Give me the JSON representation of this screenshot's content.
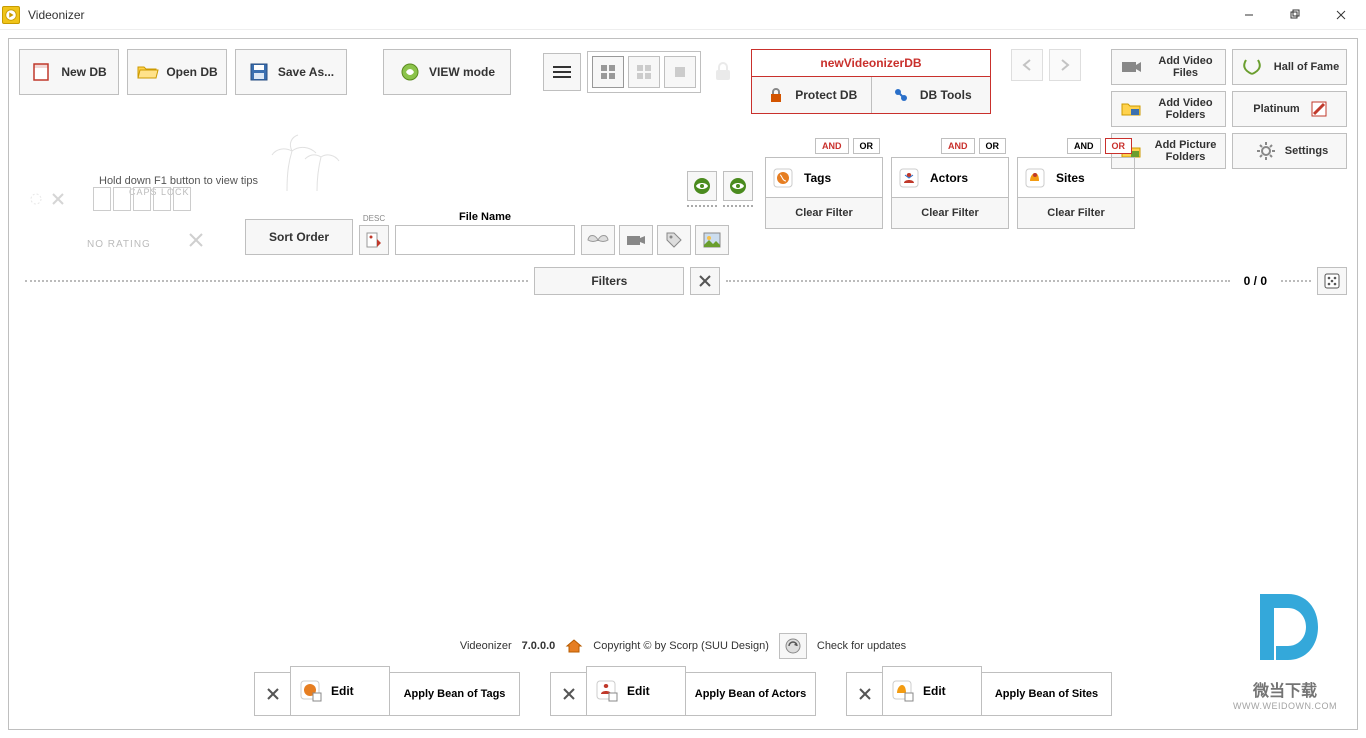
{
  "window": {
    "title": "Videonizer"
  },
  "toolbar": {
    "new_db": "New DB",
    "open_db": "Open DB",
    "save_as": "Save As...",
    "view_mode": "VIEW mode"
  },
  "db": {
    "name": "newVideonizerDB",
    "protect": "Protect DB",
    "tools": "DB Tools"
  },
  "right": {
    "add_video_files": "Add Video Files",
    "hall_of_fame": "Hall of Fame",
    "add_video_folders": "Add Video Folders",
    "platinum": "Platinum",
    "add_picture_folders": "Add Picture Folders",
    "settings": "Settings"
  },
  "tip": "Hold down F1 button to view tips",
  "caps": "CAPS LOCK",
  "no_rating": "NO RATING",
  "sort": {
    "label": "Sort Order",
    "desc": "DESC",
    "filename": "File Name"
  },
  "filters": {
    "tags": {
      "name": "Tags",
      "clear": "Clear Filter",
      "and": "AND",
      "or": "OR"
    },
    "actors": {
      "name": "Actors",
      "clear": "Clear Filter",
      "and": "AND",
      "or": "OR"
    },
    "sites": {
      "name": "Sites",
      "clear": "Clear Filter",
      "and": "AND",
      "or": "OR"
    },
    "btn": "Filters"
  },
  "count": "0 / 0",
  "footer": {
    "app": "Videonizer",
    "version": "7.0.0.0",
    "copyright": "Copyright © by Scorp (SUU Design)",
    "check": "Check for updates"
  },
  "beans": {
    "edit": "Edit",
    "tags": "Apply Bean of Tags",
    "actors": "Apply Bean of Actors",
    "sites": "Apply Bean of Sites"
  },
  "watermark": {
    "cn": "微当下载",
    "url": "WWW.WEIDOWN.COM"
  }
}
